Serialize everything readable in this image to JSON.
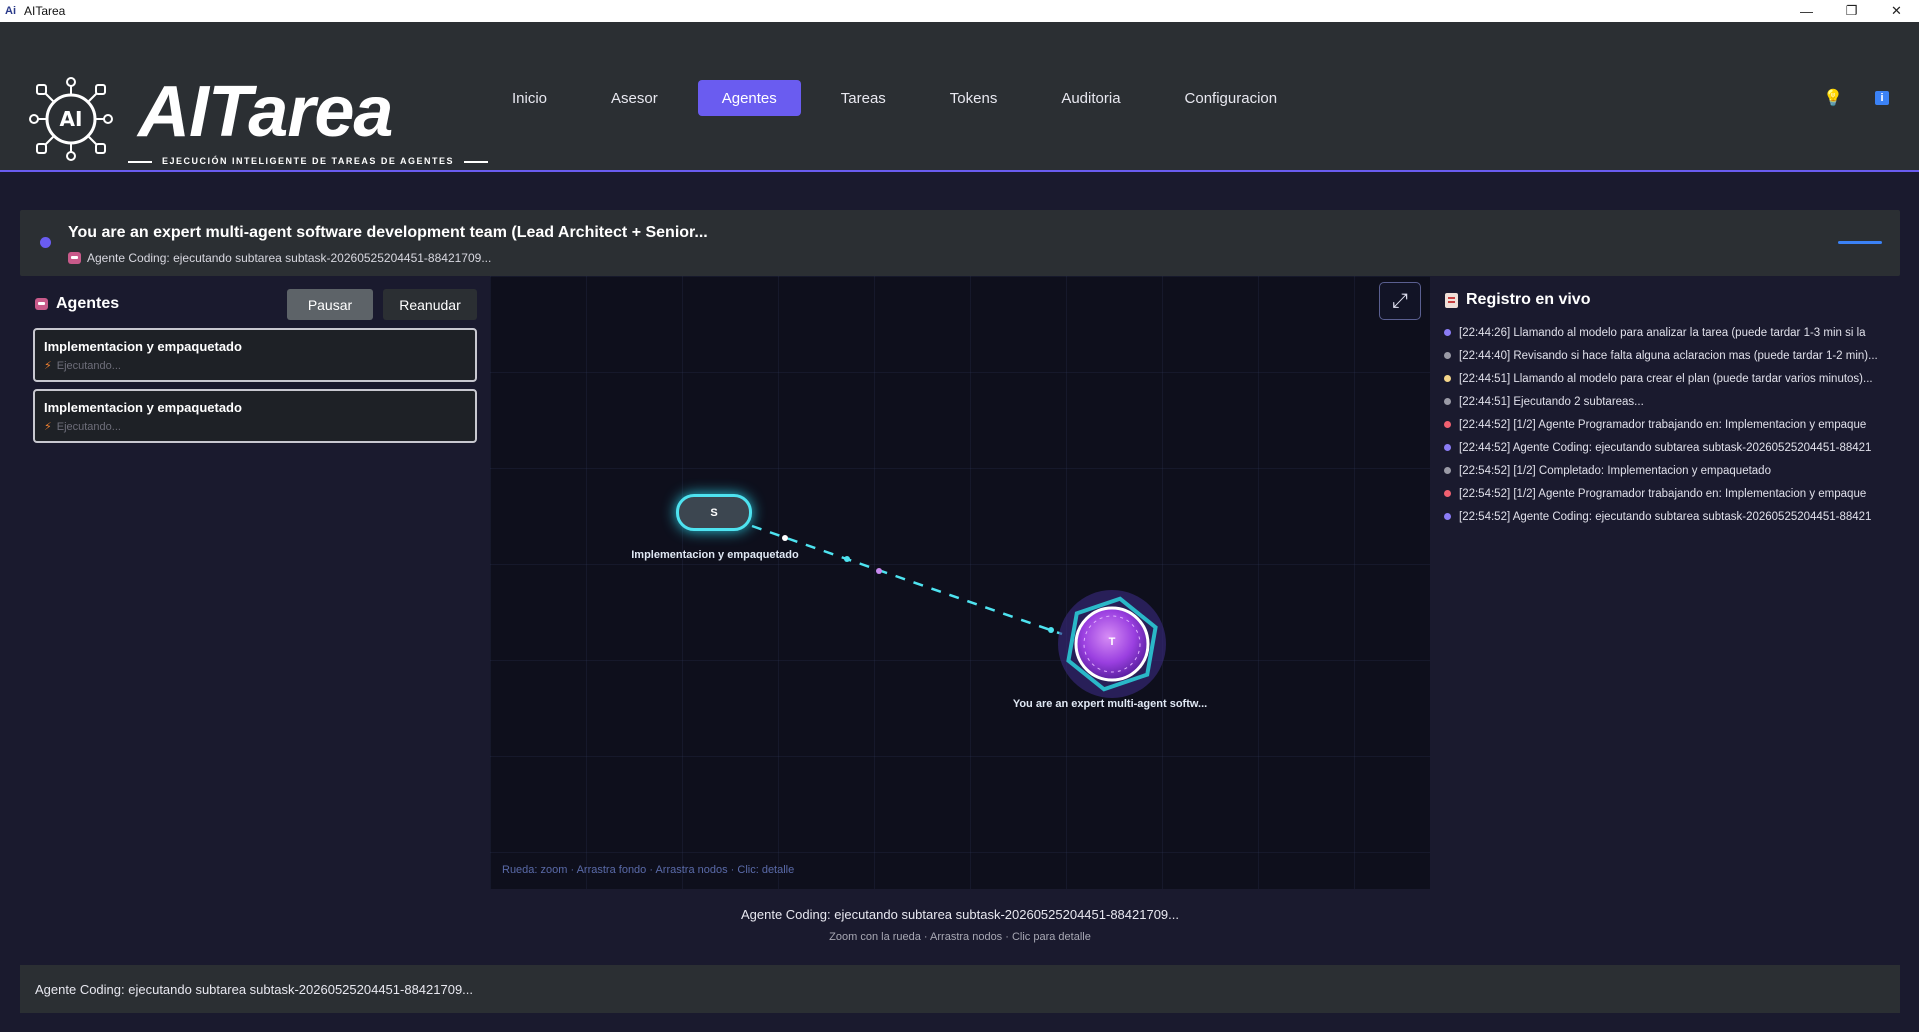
{
  "window": {
    "title": "AITarea",
    "controls": [
      "—",
      "❐",
      "✕"
    ]
  },
  "header": {
    "brand": "AITarea",
    "tagline": "EJECUCIÓN INTELIGENTE DE TAREAS DE AGENTES",
    "nav": [
      {
        "label": "Inicio",
        "active": false
      },
      {
        "label": "Asesor",
        "active": false
      },
      {
        "label": "Agentes",
        "active": true
      },
      {
        "label": "Tareas",
        "active": false
      },
      {
        "label": "Tokens",
        "active": false
      },
      {
        "label": "Auditoria",
        "active": false
      },
      {
        "label": "Configuracion",
        "active": false
      }
    ],
    "icons": [
      "bulb-icon",
      "info-icon"
    ]
  },
  "banner": {
    "task_title": "You are an expert multi-agent software development team (Lead Architect + Senior...",
    "task_sub": "Agente Coding: ejecutando subtarea subtask-20260525204451-88421709...",
    "status_color": "#6a5cf0"
  },
  "agents_panel": {
    "title": "Agentes",
    "pause_label": "Pausar",
    "resume_label": "Reanudar",
    "cards": [
      {
        "title": "Implementacion y empaquetado",
        "status": "Ejecutando..."
      },
      {
        "title": "Implementacion y empaquetado",
        "status": "Ejecutando..."
      }
    ]
  },
  "graph": {
    "node_s": {
      "glyph": "S",
      "label": "Implementacion y empaquetado"
    },
    "node_t": {
      "glyph": "T",
      "label": "You are an expert multi-agent softw..."
    },
    "hint": "Rueda: zoom · Arrastra fondo · Arrastra nodos · Clic: detalle",
    "expand_icon": "expand-icon",
    "accent": "#4ee3f0"
  },
  "log_panel": {
    "title": "Registro en vivo",
    "entries": [
      {
        "color": "#8b7cf6",
        "text": "[22:44:26] Llamando al modelo para analizar la tarea (puede tardar 1-3 min si la"
      },
      {
        "color": "#9a9aa6",
        "text": "[22:44:40] Revisando si hace falta alguna aclaracion mas (puede tardar 1-2 min)..."
      },
      {
        "color": "#f4d58a",
        "text": "[22:44:51] Llamando al modelo para crear el plan (puede tardar varios minutos)..."
      },
      {
        "color": "#9a9aa6",
        "text": "[22:44:51] Ejecutando 2 subtareas..."
      },
      {
        "color": "#f06070",
        "text": "[22:44:52] [1/2] Agente Programador trabajando en: Implementacion y empaque"
      },
      {
        "color": "#8b7cf6",
        "text": "[22:44:52] Agente Coding: ejecutando subtarea subtask-20260525204451-88421"
      },
      {
        "color": "#9a9aa6",
        "text": "[22:54:52] [1/2] Completado: Implementacion y empaquetado"
      },
      {
        "color": "#f06070",
        "text": "[22:54:52] [1/2] Agente Programador trabajando en: Implementacion y empaque"
      },
      {
        "color": "#8b7cf6",
        "text": "[22:54:52] Agente Coding: ejecutando subtarea subtask-20260525204451-88421"
      }
    ]
  },
  "bottom": {
    "status": "Agente Coding: ejecutando subtarea subtask-20260525204451-88421709...",
    "hint": "Zoom con la rueda · Arrastra nodos · Clic para detalle",
    "footer": "Agente Coding: ejecutando subtarea subtask-20260525204451-88421709..."
  }
}
